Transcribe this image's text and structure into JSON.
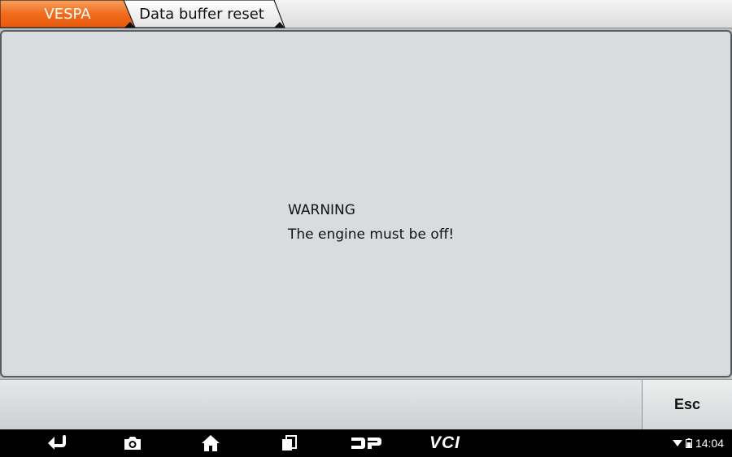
{
  "breadcrumb": {
    "items": [
      {
        "label": "VESPA"
      },
      {
        "label": "Data buffer reset"
      }
    ]
  },
  "message": {
    "title": "WARNING",
    "body": "The engine must be off!"
  },
  "buttons": {
    "esc_label": "Esc"
  },
  "navbar": {
    "icons": [
      "back-icon",
      "camera-icon",
      "home-icon",
      "recent-apps-icon",
      "dp-logo-icon",
      "vci-icon"
    ],
    "vci_label": "VCI",
    "time": "14:04"
  },
  "colors": {
    "accent_orange": "#f26b1d",
    "panel_background": "#d9dcdf",
    "navbar_background": "#000000"
  }
}
